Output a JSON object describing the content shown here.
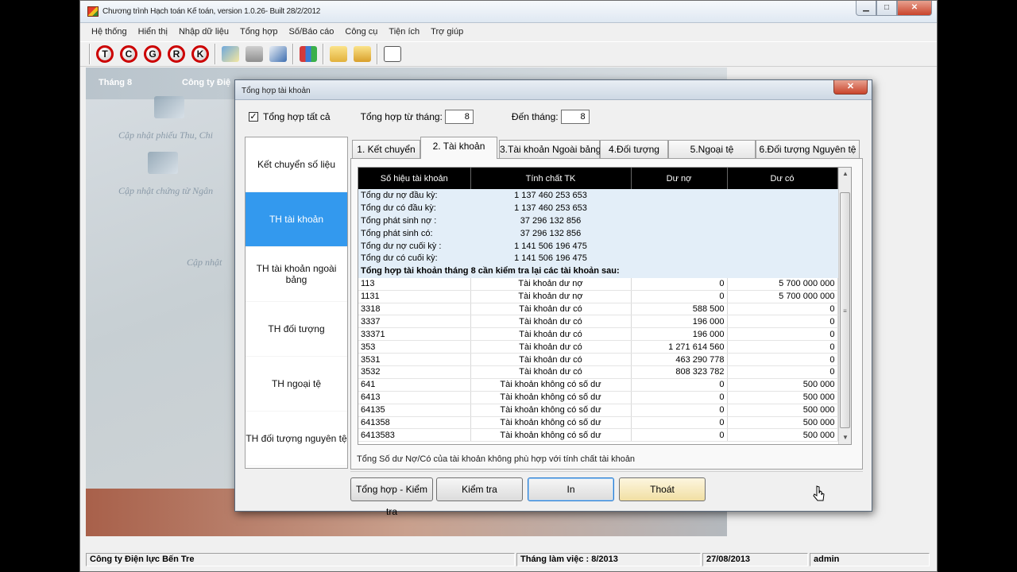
{
  "app": {
    "title": "Chương trình Hạch toán Kế toán, version 1.0.26- Built 28/2/2012",
    "menus": [
      "Hệ thống",
      "Hiển thị",
      "Nhập dữ liệu",
      "Tổng hợp",
      "Số/Báo cáo",
      "Công cụ",
      "Tiện ích",
      "Trợ giúp"
    ],
    "toolbar_letters": [
      "T",
      "C",
      "G",
      "R",
      "K"
    ]
  },
  "workarea": {
    "month_label": "Tháng 8",
    "company_label": "Công ty Điệ",
    "links": [
      "Cập nhật phiếu Thu, Chi",
      "Cập nhật chứng từ Ngân",
      "Cập nhật"
    ]
  },
  "status": {
    "company": "Công ty Điện lực Bến Tre",
    "working_month": "Tháng làm việc : 8/2013",
    "date": "27/08/2013",
    "user": "admin"
  },
  "dialog": {
    "title": "Tổng hợp tài khoản",
    "check_all_label": "Tổng hợp tất cả",
    "check_all_checked": "✓",
    "from_month_label": "Tổng hợp từ tháng:",
    "from_month": "8",
    "to_month_label": "Đến tháng:",
    "to_month": "8",
    "nav": [
      "Kết chuyển số liệu",
      "TH tài khoản",
      "TH tài khoản ngoài bảng",
      "TH đối tượng",
      "TH ngoại tệ",
      "TH đối tượng nguyên tệ"
    ],
    "active_nav": 1,
    "tabs": [
      "1. Kết chuyển",
      "2. Tài khoản",
      "3.Tài khoản Ngoài bảng",
      "4.Đối tượng",
      "5.Ngoại tệ",
      "6.Đối tượng Nguyên tệ"
    ],
    "active_tab": 1,
    "grid": {
      "columns": [
        "Số hiệu tài khoản",
        "Tính chất TK",
        "Dư nợ",
        "Dư có"
      ],
      "summary_rows": [
        [
          "Tổng dư nợ đầu kỳ:",
          "1 137 460 253 653"
        ],
        [
          "Tổng dư có đầu kỳ:",
          "1 137 460 253 653"
        ],
        [
          "Tổng phát sinh nợ :",
          "37 296 132 856"
        ],
        [
          "Tổng phát sinh có:",
          "37 296 132 856"
        ],
        [
          "Tổng dư nợ cuối kỳ :",
          "1 141 506 196 475"
        ],
        [
          "Tổng dư có cuối kỳ:",
          "1 141 506 196 475"
        ]
      ],
      "highlight_row": "Tổng hợp tài khoản tháng  8 cần kiểm tra lại các tài khoản sau:",
      "rows": [
        [
          "113",
          "Tài khoản dư nợ",
          "0",
          "5 700 000 000"
        ],
        [
          "1131",
          "Tài khoản dư nợ",
          "0",
          "5 700 000 000"
        ],
        [
          "3318",
          "Tài khoản dư có",
          "588 500",
          "0"
        ],
        [
          "3337",
          "Tài khoản dư có",
          "196 000",
          "0"
        ],
        [
          "33371",
          "Tài khoản dư có",
          "196 000",
          "0"
        ],
        [
          "353",
          "Tài khoản dư có",
          "1 271 614 560",
          "0"
        ],
        [
          "3531",
          "Tài khoản dư có",
          "463 290 778",
          "0"
        ],
        [
          "3532",
          "Tài khoản dư có",
          "808 323 782",
          "0"
        ],
        [
          "641",
          "Tài khoản không có số dư",
          "0",
          "500 000"
        ],
        [
          "6413",
          "Tài khoản không có số dư",
          "0",
          "500 000"
        ],
        [
          "64135",
          "Tài khoản không có số dư",
          "0",
          "500 000"
        ],
        [
          "641358",
          "Tài khoản không có số dư",
          "0",
          "500 000"
        ],
        [
          "6413583",
          "Tài khoản không có số dư",
          "0",
          "500 000"
        ]
      ]
    },
    "footnote": "Tổng Số dư Nợ/Có của tài khoản không phù hợp với tính chất tài khoản",
    "buttons": {
      "summarize_check": "Tổng hợp - Kiểm tra",
      "check": "Kiểm tra",
      "print": "In",
      "exit": "Thoát"
    }
  }
}
